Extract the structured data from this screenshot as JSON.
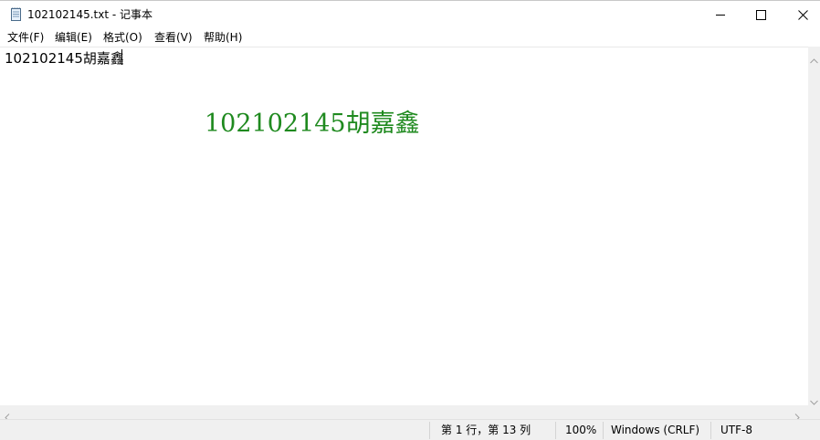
{
  "window": {
    "title": "102102145.txt - 记事本"
  },
  "menu": {
    "items": [
      "文件(F)",
      "编辑(E)",
      "格式(O)",
      "查看(V)",
      "帮助(H)"
    ]
  },
  "editor": {
    "content": "102102145胡嘉鑫"
  },
  "overlay": {
    "text": "102102145胡嘉鑫",
    "color": "#1f8a1f"
  },
  "statusbar": {
    "position": "第 1 行，第 13 列",
    "zoom": "100%",
    "line_ending": "Windows (CRLF)",
    "encoding": "UTF-8"
  },
  "icons": {
    "app": "notepad-icon",
    "minimize": "minimize-icon",
    "maximize": "maximize-icon",
    "close": "close-icon"
  }
}
